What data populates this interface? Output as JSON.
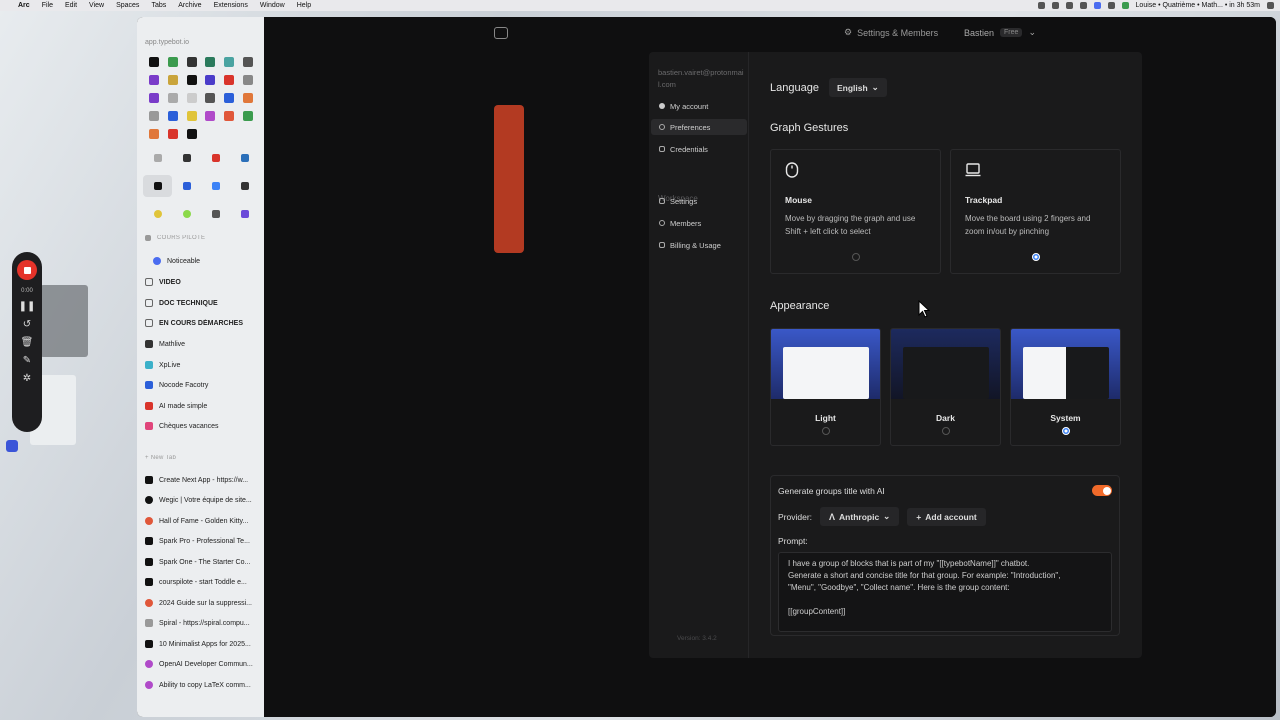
{
  "menubar": {
    "app": "Arc",
    "items": [
      "File",
      "Edit",
      "View",
      "Spaces",
      "Tabs",
      "Archive",
      "Extensions",
      "Window",
      "Help"
    ],
    "status": "Louise • Quatrième • Math... • in 3h 53m"
  },
  "recorder": {
    "time": "0:00"
  },
  "sidebar": {
    "url": "app.typebot.io",
    "section_cours": "COURS PILOTE",
    "items": [
      {
        "label": "Noticeable",
        "color": "#4a6cf0",
        "kind": "link"
      },
      {
        "label": "VIDEO",
        "kind": "folder"
      },
      {
        "label": "DOC TECHNIQUE",
        "kind": "folder"
      },
      {
        "label": "EN COURS DÉMARCHES",
        "kind": "folder"
      },
      {
        "label": "Mathlive",
        "color": "#333",
        "kind": "link"
      },
      {
        "label": "XpLive",
        "color": "#3bb0c9",
        "kind": "link"
      },
      {
        "label": "Nocode Facotry",
        "color": "#2b5fd9",
        "kind": "link"
      },
      {
        "label": "AI made simple",
        "color": "#d9342b",
        "kind": "link"
      },
      {
        "label": "Chèques vacances",
        "color": "#e0457b",
        "kind": "link"
      }
    ],
    "new_tab": "+ New Tab",
    "tabs": [
      {
        "label": "Create Next App - https://w...",
        "color": "#111"
      },
      {
        "label": "Wegic | Votre équipe de site...",
        "color": "#111"
      },
      {
        "label": "Hall of Fame - Golden Kitty...",
        "color": "#e0573a"
      },
      {
        "label": "Spark Pro - Professional Te...",
        "color": "#111"
      },
      {
        "label": "Spark One - The Starter Co...",
        "color": "#111"
      },
      {
        "label": "courspilote - start Toddle e...",
        "color": "#111"
      },
      {
        "label": "2024 Guide sur la suppressi...",
        "color": "#e0573a"
      },
      {
        "label": "Spiral - https://spiral.compu...",
        "color": "#999"
      },
      {
        "label": "10 Minimalist Apps for 2025...",
        "color": "#111"
      },
      {
        "label": "OpenAI Developer Commun...",
        "color": "#b04ac9"
      },
      {
        "label": "Ability to copy LaTeX comm...",
        "color": "#b04ac9"
      }
    ]
  },
  "topbar": {
    "settings_label": "Settings & Members",
    "workspace": "Bastien",
    "plan": "Free"
  },
  "modal": {
    "email": "bastien.vairet@protonmail.com",
    "nav": [
      {
        "label": "My account",
        "active": false
      },
      {
        "label": "Preferences",
        "active": true
      },
      {
        "label": "Credentials",
        "active": false
      }
    ],
    "workspace_label": "Workspace",
    "workspace_nav": [
      {
        "label": "Settings"
      },
      {
        "label": "Members"
      },
      {
        "label": "Billing & Usage"
      }
    ],
    "version": "Version: 3.4.2",
    "language_label": "Language",
    "language_value": "English",
    "graph_gestures_title": "Graph Gestures",
    "gestures": [
      {
        "title": "Mouse",
        "desc": "Move by dragging the graph and use Shift + left click to select",
        "selected": false
      },
      {
        "title": "Trackpad",
        "desc": "Move the board using 2 fingers and zoom in/out by pinching",
        "selected": true
      }
    ],
    "appearance_title": "Appearance",
    "appearance": [
      {
        "title": "Light",
        "selected": false
      },
      {
        "title": "Dark",
        "selected": false
      },
      {
        "title": "System",
        "selected": true
      }
    ],
    "ai": {
      "label": "Generate groups title with AI",
      "enabled": true,
      "provider_label": "Provider:",
      "provider": "Anthropic",
      "add_account": "Add account",
      "prompt_label": "Prompt:",
      "prompt": "I have a group of blocks that is part of my \"[[typebotName]]\" chatbot.\nGenerate a short and concise title for that group. For example: \"Introduction\",\n\"Menu\", \"Goodbye\", \"Collect name\". Here is the group content:\n\n[[groupContent]]"
    }
  },
  "colors": {
    "accent": "#f06a2a",
    "radio_on": "#3b82f6",
    "record": "#e5332a"
  }
}
